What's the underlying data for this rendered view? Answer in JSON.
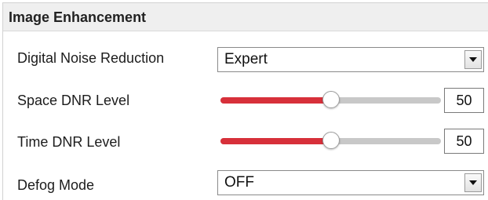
{
  "panel": {
    "title": "Image Enhancement"
  },
  "rows": {
    "dnr": {
      "label": "Digital Noise Reduction",
      "selected": "Expert",
      "arrow_icon": "triangle-down-icon"
    },
    "space_dnr": {
      "label": "Space DNR Level",
      "value": "50",
      "level": 50,
      "max": 100
    },
    "time_dnr": {
      "label": "Time DNR Level",
      "value": "50",
      "level": 50,
      "max": 100
    },
    "defog": {
      "label": "Defog Mode",
      "selected": "OFF",
      "arrow_icon": "triangle-down-icon"
    }
  },
  "colors": {
    "slider_fill": "#d7303a",
    "slider_track": "#c8c8c8",
    "header_bg": "#efefef"
  }
}
